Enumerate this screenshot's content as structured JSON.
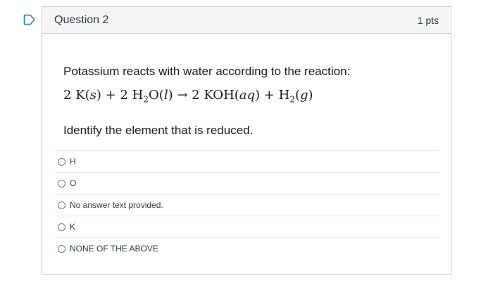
{
  "question": {
    "title": "Question 2",
    "points": "1 pts",
    "prompt": "Potassium reacts with water according to the reaction:",
    "equation": {
      "coef1": "2",
      "k": "K",
      "s": "s",
      "coef2": "2",
      "h": "H",
      "h_sub": "2",
      "o": "O",
      "l": "l",
      "arrow": "→",
      "coef3": "2",
      "koh": "KOH",
      "aq": "aq",
      "h2": "H",
      "h2_sub": "2",
      "g": "g"
    },
    "instruction": "Identify the element that is reduced."
  },
  "answers": [
    {
      "label": "H"
    },
    {
      "label": "O"
    },
    {
      "label": "No answer text provided."
    },
    {
      "label": "K"
    },
    {
      "label": "NONE OF THE ABOVE"
    }
  ],
  "colors": {
    "flag": "#2b7abc",
    "header_bg": "#f5f5f5",
    "border": "#c7cdd1"
  },
  "icons": {
    "flag": "bookmark-flag-icon",
    "radio": "radio-button-icon"
  }
}
